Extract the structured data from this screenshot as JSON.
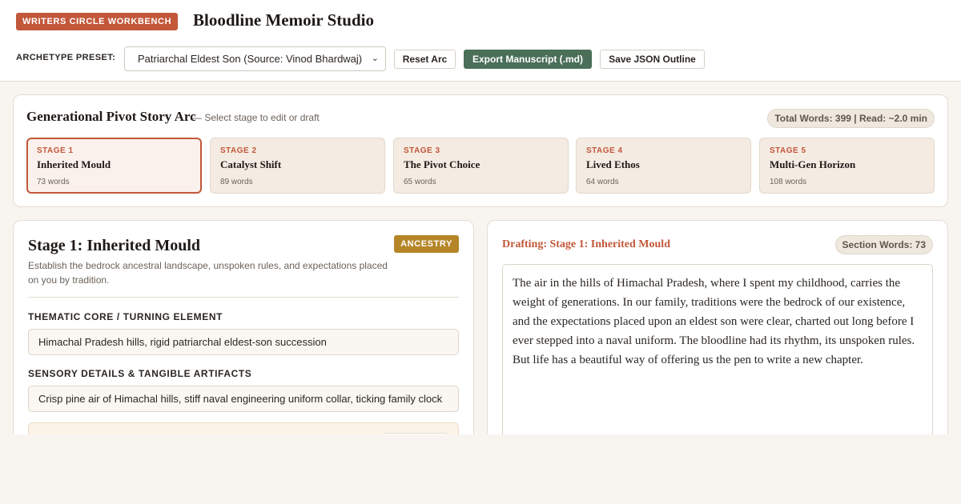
{
  "header": {
    "brand_badge": "WRITERS CIRCLE WORKBENCH",
    "app_title": "Bloodline Memoir Studio",
    "preset_label": "ARCHETYPE PRESET:",
    "preset_selected": "Patriarchal Eldest Son (Source: Vinod Bhardwaj)",
    "buttons": {
      "reset": "Reset Arc",
      "export": "Export Manuscript (.md)",
      "save": "Save JSON Outline"
    }
  },
  "arc": {
    "title": "Generational Pivot Story Arc",
    "subtitle": "— Select stage to edit or draft",
    "totals": "Total Words: 399 | Read: ~2.0 min",
    "stages": [
      {
        "num": "STAGE 1",
        "name": "Inherited Mould",
        "words": "73 words"
      },
      {
        "num": "STAGE 2",
        "name": "Catalyst Shift",
        "words": "89 words"
      },
      {
        "num": "STAGE 3",
        "name": "The Pivot Choice",
        "words": "65 words"
      },
      {
        "num": "STAGE 4",
        "name": "Lived Ethos",
        "words": "64 words"
      },
      {
        "num": "STAGE 5",
        "name": "Multi-Gen Horizon",
        "words": "108 words"
      }
    ]
  },
  "editor": {
    "title": "Stage 1: Inherited Mould",
    "badge": "ANCESTRY",
    "description": "Establish the bedrock ancestral landscape, unspoken rules, and expectations placed on you by tradition.",
    "thematic_label": "THEMATIC CORE / TURNING ELEMENT",
    "thematic_value": "Himachal Pradesh hills, rigid patriarchal eldest-son succession",
    "sensory_label": "SENSORY DETAILS & TANGIBLE ARTIFACTS",
    "sensory_value": "Crisp pine air of Himachal hills, stiff naval engineering uniform collar, ticking family clock"
  },
  "draft": {
    "title": "Drafting: Stage 1: Inherited Mould",
    "section_words": "Section Words: 73",
    "text": "The air in the hills of Himachal Pradesh, where I spent my childhood, carries the weight of generations. In our family, traditions were the bedrock of our existence, and the expectations placed upon an eldest son were clear, charted out long before I ever stepped into a naval uniform. The bloodline had its rhythm, its unspoken rules. But life has a beautiful way of offering us the pen to write a new chapter."
  },
  "colors": {
    "accent": "#c2573a",
    "export_green": "#4a6e58",
    "ancestry_gold": "#b58628",
    "background": "#f8f5f0"
  }
}
